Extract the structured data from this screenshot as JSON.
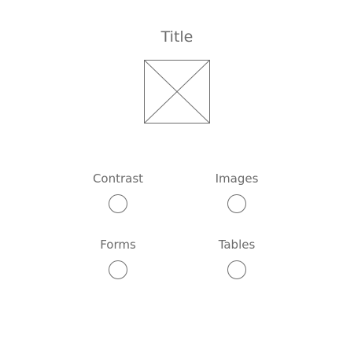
{
  "header": {
    "title": "Title"
  },
  "image": {
    "icon": "image-placeholder-icon",
    "stroke_color": "#6e6e6e"
  },
  "options": [
    {
      "label": "Contrast",
      "selected": false
    },
    {
      "label": "Images",
      "selected": false
    },
    {
      "label": "Forms",
      "selected": false
    },
    {
      "label": "Tables",
      "selected": false
    }
  ],
  "colors": {
    "text": "#6b6b6b",
    "background": "#ffffff",
    "outline": "#6e6e6e"
  }
}
